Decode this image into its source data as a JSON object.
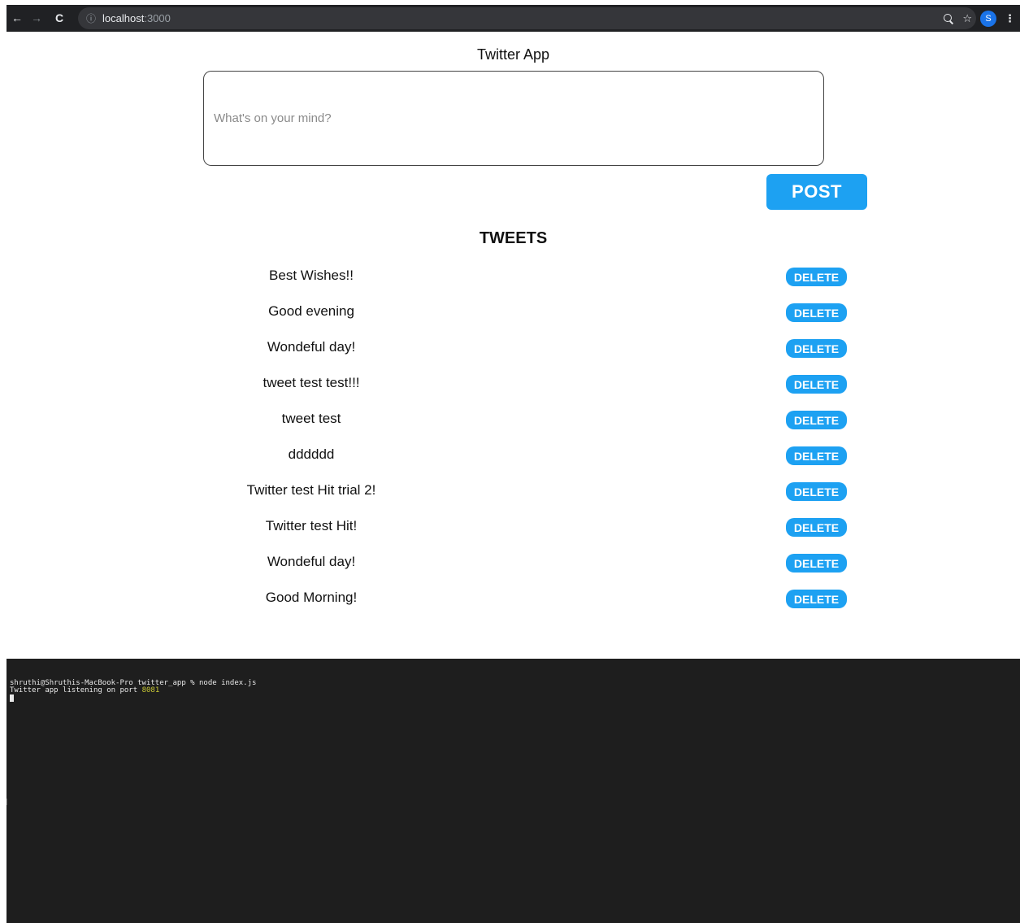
{
  "browser": {
    "back_icon": "←",
    "forward_icon": "→",
    "reload_icon": "C",
    "info_icon": "ⓘ",
    "url_host": "localhost",
    "url_port": ":3000",
    "star_icon": "☆",
    "profile_initial": "S",
    "menu_icon": "⋮"
  },
  "app": {
    "title": "Twitter App",
    "input_placeholder": "What's on your mind?",
    "post_label": "POST",
    "tweets_heading": "TWEETS",
    "delete_label": "DELETE",
    "tweets": [
      "Best Wishes!!",
      "Good evening",
      "Wondeful day!",
      "tweet test test!!!",
      "tweet test",
      "dddddd",
      "Twitter test Hit trial 2!",
      "Twitter test Hit!",
      "Wondeful day!",
      "Good Morning!"
    ]
  },
  "terminal": {
    "prompt_line": "shruthi@Shruthis-MacBook-Pro twitter_app % node index.js",
    "output_prefix": "Twitter app listening on port ",
    "output_port": "8081"
  },
  "colors": {
    "accent": "#1da1f2",
    "browser_bar": "#202124",
    "terminal_bg": "#1e1e1e",
    "terminal_port": "#c9c934"
  }
}
